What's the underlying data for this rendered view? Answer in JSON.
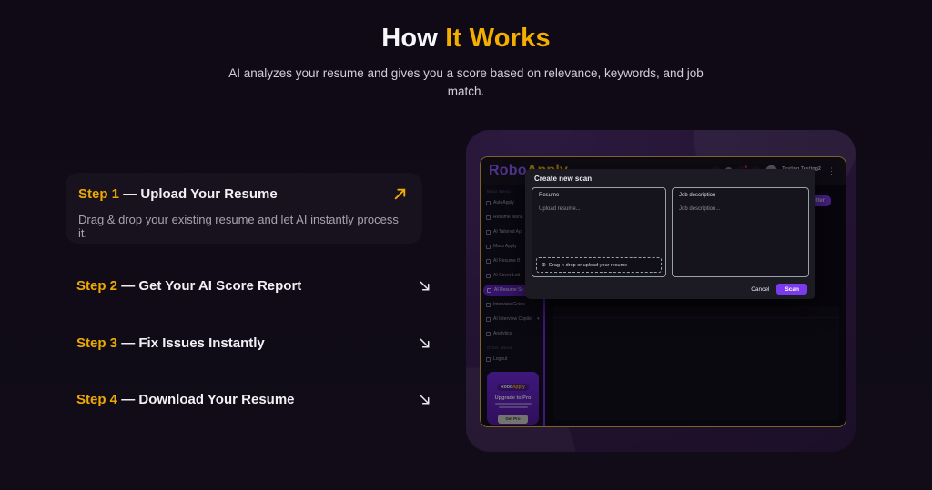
{
  "header": {
    "title_prefix": "How",
    "title_accent": "It Works",
    "subtitle": "AI analyzes your resume and gives you a score based on relevance, keywords, and job match."
  },
  "steps": [
    {
      "label": "Step 1",
      "dash": "—",
      "title": "Upload Your Resume",
      "description": "Drag & drop your existing resume and let AI instantly process it."
    },
    {
      "label": "Step 2",
      "dash": "—",
      "title": "Get Your AI Score Report"
    },
    {
      "label": "Step 3",
      "dash": "—",
      "title": "Fix Issues Instantly"
    },
    {
      "label": "Step 4",
      "dash": "—",
      "title": "Download Your Resume"
    }
  ],
  "app": {
    "logo": {
      "primary": "Robo",
      "accent": "Apply"
    },
    "topbar": {
      "user_name": "Testing Testing2",
      "menu_icon": "⋮"
    },
    "cover_letter_button": "Letter",
    "sidebar": {
      "section_main": "Main Menu",
      "items": [
        {
          "label": "AutoApply"
        },
        {
          "label": "Resume Mana"
        },
        {
          "label": "AI Tailored Ap"
        },
        {
          "label": "Mass Apply"
        },
        {
          "label": "AI Resume B"
        },
        {
          "label": "AI Cover Lett"
        },
        {
          "label": "AI Resume Sc"
        },
        {
          "label": "Interview Guide"
        },
        {
          "label": "AI Interview Copilot",
          "chevron": "▾"
        },
        {
          "label": "Analytics"
        }
      ],
      "section_other": "Other Menu",
      "logout_label": "Logout",
      "upgrade": {
        "brand_primary": "Robo",
        "brand_accent": "Apply",
        "title": "Upgrade to Pro",
        "button": "Get Pro"
      }
    },
    "modal": {
      "title": "Create new scan",
      "resume_label": "Resume",
      "resume_placeholder": "Upload resume...",
      "dropzone_icon": "⊕",
      "dropzone_text": "Drag-n-drop or upload your resume",
      "job_label": "Job description",
      "job_placeholder": "Job description...",
      "cancel": "Cancel",
      "scan": "Scan"
    }
  },
  "colors": {
    "accent_yellow": "#f3ae00",
    "accent_purple": "#7c3aed"
  }
}
